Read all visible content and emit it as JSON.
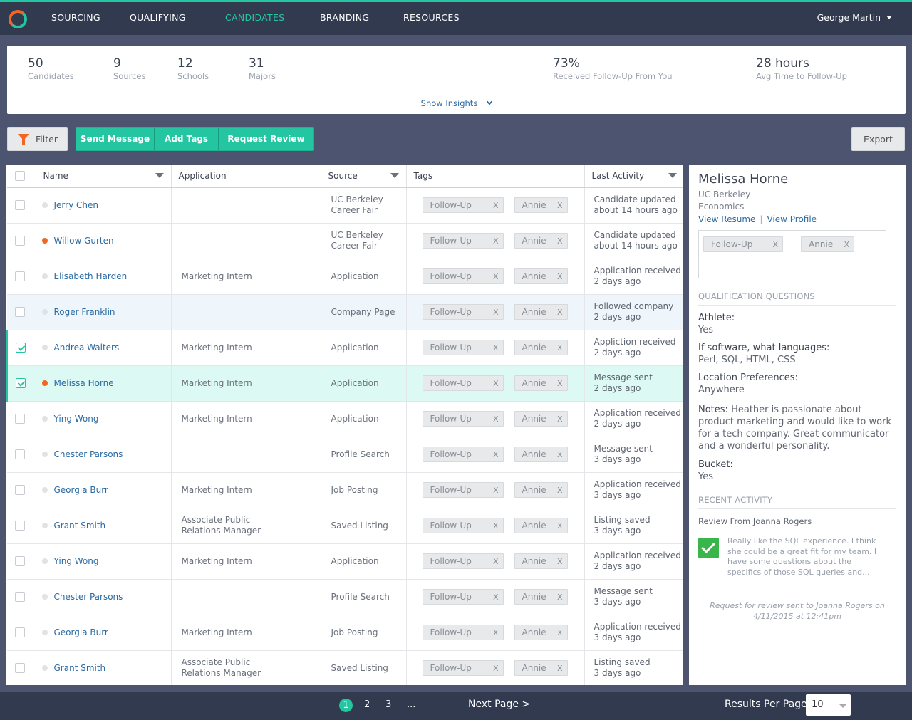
{
  "nav": {
    "items": [
      "SOURCING",
      "QUALIFYING",
      "CANDIDATES",
      "BRANDING",
      "RESOURCES"
    ],
    "active": "CANDIDATES",
    "user": "George Martin"
  },
  "stats": [
    {
      "value": "50",
      "label": "Candidates"
    },
    {
      "value": "9",
      "label": "Sources"
    },
    {
      "value": "12",
      "label": "Schools"
    },
    {
      "value": "31",
      "label": "Majors"
    },
    {
      "value": "73%",
      "label": "Received Follow-Up From You"
    },
    {
      "value": "28 hours",
      "label": "Avg Time to Follow-Up"
    }
  ],
  "insights_label": "Show Insights",
  "toolbar": {
    "filter": "Filter",
    "send_message": "Send Message",
    "add_tags": "Add Tags",
    "request_review": "Request Review",
    "export": "Export"
  },
  "table": {
    "columns": [
      "Name",
      "Application",
      "Source",
      "Tags",
      "Last Activity"
    ],
    "tag_close": "X",
    "rows": [
      {
        "name": "Jerry Chen",
        "dot": "none",
        "application": "",
        "source": [
          "UC Berkeley",
          "Career Fair"
        ],
        "tags": [
          "Follow-Up",
          "Annie"
        ],
        "activity": [
          "Candidate updated",
          "about 14 hours ago"
        ],
        "checked": false,
        "state": ""
      },
      {
        "name": "Willow Gurten",
        "dot": "red",
        "application": "",
        "source": [
          "UC Berkeley",
          "Career Fair"
        ],
        "tags": [
          "Follow-Up",
          "Annie"
        ],
        "activity": [
          "Candidate updated",
          "about 14 hours ago"
        ],
        "checked": false,
        "state": ""
      },
      {
        "name": "Elisabeth Harden",
        "dot": "none",
        "application": "Marketing Intern",
        "source": [
          "Application"
        ],
        "tags": [
          "Follow-Up",
          "Annie"
        ],
        "activity": [
          "Application received",
          "2 days ago"
        ],
        "checked": false,
        "state": ""
      },
      {
        "name": "Roger Franklin",
        "dot": "none",
        "application": "",
        "source": [
          "Company Page"
        ],
        "tags": [
          "Follow-Up",
          "Annie"
        ],
        "activity": [
          "Followed company",
          "2 days ago"
        ],
        "checked": false,
        "state": "hover"
      },
      {
        "name": "Andrea Walters",
        "dot": "none",
        "application": "Marketing Intern",
        "source": [
          "Application"
        ],
        "tags": [
          "Follow-Up",
          "Annie"
        ],
        "activity": [
          "Appliction received",
          "2 days ago"
        ],
        "checked": true,
        "state": ""
      },
      {
        "name": "Melissa Horne",
        "dot": "red",
        "application": "Marketing Intern",
        "source": [
          "Application"
        ],
        "tags": [
          "Follow-Up",
          "Annie"
        ],
        "activity": [
          "Message sent",
          "2 days ago"
        ],
        "checked": true,
        "state": "selected"
      },
      {
        "name": "Ying Wong",
        "dot": "none",
        "application": "Marketing Intern",
        "source": [
          "Application"
        ],
        "tags": [
          "Follow-Up",
          "Annie"
        ],
        "activity": [
          "Application received",
          "2 days ago"
        ],
        "checked": false,
        "state": ""
      },
      {
        "name": "Chester Parsons",
        "dot": "none",
        "application": "",
        "source": [
          "Profile Search"
        ],
        "tags": [
          "Follow-Up",
          "Annie"
        ],
        "activity": [
          "Message sent",
          "3 days ago"
        ],
        "checked": false,
        "state": ""
      },
      {
        "name": "Georgia Burr",
        "dot": "none",
        "application": "Marketing Intern",
        "source": [
          "Job Posting"
        ],
        "tags": [
          "Follow-Up",
          "Annie"
        ],
        "activity": [
          "Application received",
          "3 days ago"
        ],
        "checked": false,
        "state": ""
      },
      {
        "name": "Grant Smith",
        "dot": "none",
        "application": "Associate Public Relations Manager",
        "source": [
          "Saved Listing"
        ],
        "tags": [
          "Follow-Up",
          "Annie"
        ],
        "activity": [
          "Listing saved",
          "3 days ago"
        ],
        "checked": false,
        "state": ""
      },
      {
        "name": "Ying Wong",
        "dot": "none",
        "application": "Marketing Intern",
        "source": [
          "Application"
        ],
        "tags": [
          "Follow-Up",
          "Annie"
        ],
        "activity": [
          "Application received",
          "2 days ago"
        ],
        "checked": false,
        "state": ""
      },
      {
        "name": "Chester Parsons",
        "dot": "none",
        "application": "",
        "source": [
          "Profile Search"
        ],
        "tags": [
          "Follow-Up",
          "Annie"
        ],
        "activity": [
          "Message sent",
          "3 days ago"
        ],
        "checked": false,
        "state": ""
      },
      {
        "name": "Georgia Burr",
        "dot": "none",
        "application": "Marketing Intern",
        "source": [
          "Job Posting"
        ],
        "tags": [
          "Follow-Up",
          "Annie"
        ],
        "activity": [
          "Application received",
          "3 days ago"
        ],
        "checked": false,
        "state": ""
      },
      {
        "name": "Grant Smith",
        "dot": "none",
        "application": "Associate Public Relations Manager",
        "source": [
          "Saved Listing"
        ],
        "tags": [
          "Follow-Up",
          "Annie"
        ],
        "activity": [
          "Listing saved",
          "3 days ago"
        ],
        "checked": false,
        "state": ""
      }
    ]
  },
  "detail": {
    "name": "Melissa Horne",
    "school": "UC Berkeley",
    "major": "Economics",
    "view_resume": "View Resume",
    "separator": "|",
    "view_profile": "View Profile",
    "tags": [
      "Follow-Up",
      "Annie"
    ],
    "qualification_title": "QUALIFICATION QUESTIONS",
    "questions": [
      {
        "q": "Athlete:",
        "a": "Yes"
      },
      {
        "q": "If software, what languages:",
        "a": "Perl, SQL, HTML, CSS"
      },
      {
        "q": "Location Preferences:",
        "a": "Anywhere"
      }
    ],
    "notes_label": "Notes:",
    "notes_text": "Heather is passionate about product marketing and would like to work for a tech company. Great communicator and a wonderful personality.",
    "bucket_label": "Bucket:",
    "bucket_value": "Yes",
    "recent_title": "RECENT ACTIVITY",
    "review_from": "Review From Joanna Rogers",
    "review_text": "Really like the SQL experience. I think she could be a great fit for my team. I have some questions about the specifics of those SQL queries and...",
    "request_note": "Request for review sent to Joanna Rogers on 4/11/2015 at 12:41pm"
  },
  "pagination": {
    "pages": [
      "1",
      "2",
      "3",
      "..."
    ],
    "current": "1",
    "next": "Next Page >",
    "rpp_label": "Results Per Page:",
    "rpp_value": "10"
  },
  "colors": {
    "accent": "#23c6a0",
    "orange": "#f26522",
    "nav_bg": "#323a50",
    "page_bg": "#4c5470",
    "link": "#2b6aa3"
  }
}
